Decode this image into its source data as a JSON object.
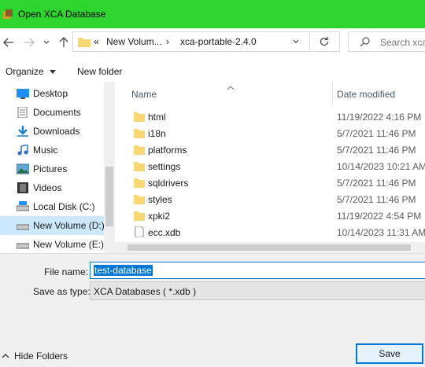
{
  "window": {
    "title": "Open XCA Database"
  },
  "address": {
    "overflow": "«",
    "crumbs": [
      "New Volum...",
      "xca-portable-2.4.0"
    ],
    "search_placeholder": "Search xca"
  },
  "toolbar": {
    "organize": "Organize",
    "new_folder": "New folder"
  },
  "nav_pane": {
    "items": [
      {
        "label": "Desktop",
        "icon": "desktop-icon"
      },
      {
        "label": "Documents",
        "icon": "documents-icon"
      },
      {
        "label": "Downloads",
        "icon": "downloads-icon"
      },
      {
        "label": "Music",
        "icon": "music-icon"
      },
      {
        "label": "Pictures",
        "icon": "pictures-icon"
      },
      {
        "label": "Videos",
        "icon": "videos-icon"
      },
      {
        "label": "Local Disk (C:)",
        "icon": "drive-icon"
      },
      {
        "label": "New Volume (D:)",
        "icon": "drive-icon",
        "selected": true
      },
      {
        "label": "New Volume (E:)",
        "icon": "drive-icon"
      }
    ]
  },
  "files": {
    "columns": {
      "name": "Name",
      "date": "Date modified"
    },
    "rows": [
      {
        "name": "html",
        "date": "11/19/2022 4:16 PM",
        "type": "folder"
      },
      {
        "name": "i18n",
        "date": "5/7/2021 11:46 PM",
        "type": "folder"
      },
      {
        "name": "platforms",
        "date": "5/7/2021 11:46 PM",
        "type": "folder"
      },
      {
        "name": "settings",
        "date": "10/14/2023 10:21 AM",
        "type": "folder"
      },
      {
        "name": "sqldrivers",
        "date": "5/7/2021 11:46 PM",
        "type": "folder"
      },
      {
        "name": "styles",
        "date": "5/7/2021 11:46 PM",
        "type": "folder"
      },
      {
        "name": "xpki2",
        "date": "11/19/2022 4:54 PM",
        "type": "folder"
      },
      {
        "name": "ecc.xdb",
        "date": "10/14/2023 11:31 AM",
        "type": "file"
      }
    ]
  },
  "form": {
    "file_name_label": "File name:",
    "file_name_value": "test-database",
    "save_as_type_label": "Save as type:",
    "save_as_type_value": "XCA Databases ( *.xdb )"
  },
  "footer": {
    "hide_folders": "Hide Folders",
    "save": "Save"
  },
  "colors": {
    "title_bar": "#2ed52e",
    "accent": "#0078d7",
    "folder": "#f8d775",
    "selection": "#cce8ff"
  }
}
